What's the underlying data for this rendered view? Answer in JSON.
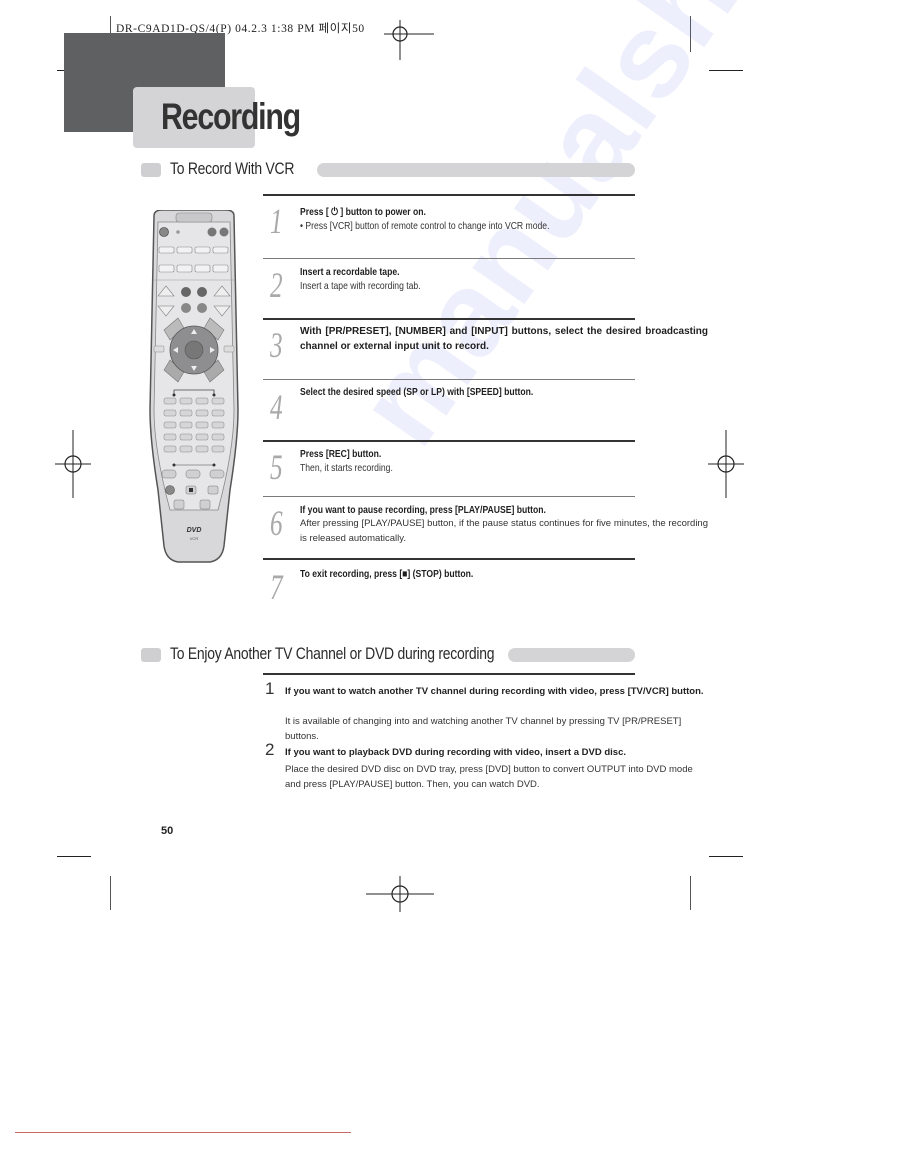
{
  "slug": "DR-C9AD1D-QS/4(P)  04.2.3 1:38 PM 페이지50",
  "page_title": "Recording",
  "section1": {
    "title": "To Record With VCR",
    "steps": [
      {
        "num": "1",
        "head": "Press [ ⏻ ] button to power on.",
        "body": "• Press [VCR] button of remote control to change into VCR mode."
      },
      {
        "num": "2",
        "head": "Insert a recordable tape.",
        "body": "Insert a tape with recording tab."
      },
      {
        "num": "3",
        "head": "With [PR/PRESET], [NUMBER] and [INPUT] buttons, select the desired broadcasting channel or external input unit to record.",
        "body": ""
      },
      {
        "num": "4",
        "head": "Select the desired speed (SP or LP) with [SPEED] button.",
        "body": ""
      },
      {
        "num": "5",
        "head": "Press [REC] button.",
        "body": "Then, it starts recording."
      },
      {
        "num": "6",
        "head": "If you want to pause recording, press [PLAY/PAUSE] button.",
        "body": "After pressing [PLAY/PAUSE] button, if the pause status continues for five minutes, the recording is released automatically."
      },
      {
        "num": "7",
        "head": "To exit recording, press [■] (STOP) button.",
        "body": ""
      }
    ]
  },
  "section2": {
    "title": "To Enjoy Another TV Channel or DVD during recording",
    "items": [
      {
        "num": "1",
        "head": "If you want to watch another TV channel during recording with video, press [TV/VCR] button.",
        "body": "It is available of changing into and watching another TV channel by pressing TV [PR/PRESET] buttons."
      },
      {
        "num": "2",
        "head": "If you want to playback DVD during recording with video, insert a DVD disc.",
        "body": "Place the desired DVD disc on DVD tray, press [DVD] button to convert OUTPUT into DVD mode and press [PLAY/PAUSE] button. Then, you can watch DVD."
      }
    ]
  },
  "remote": {
    "label_dvd": "DVD",
    "label_vcr": "VCR"
  },
  "page_number": "50",
  "watermark": "manualshive.com",
  "colors": {
    "dark_block": "#5f6062",
    "tab_gray": "#d4d4d6",
    "step_number_gray": "#a9a9ab",
    "bottom_rule_red": "#c96a6a"
  }
}
